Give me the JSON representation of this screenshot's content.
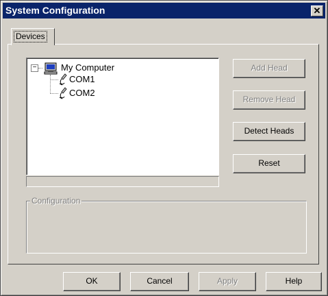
{
  "window": {
    "title": "System Configuration"
  },
  "tabs": [
    {
      "label": "Devices"
    }
  ],
  "tree": {
    "root": {
      "label": "My Computer",
      "expanded": true,
      "expander_glyph": "−",
      "icon": "computer-icon"
    },
    "children": [
      {
        "label": "COM1",
        "icon": "serial-port-icon"
      },
      {
        "label": "COM2",
        "icon": "serial-port-icon"
      }
    ]
  },
  "buttons": {
    "add_head": {
      "label": "Add Head",
      "enabled": false
    },
    "remove_head": {
      "label": "Remove Head",
      "enabled": false
    },
    "detect_heads": {
      "label": "Detect Heads",
      "enabled": true
    },
    "reset": {
      "label": "Reset",
      "enabled": true
    }
  },
  "configuration_group": {
    "label": "Configuration"
  },
  "footer_buttons": {
    "ok": {
      "label": "OK",
      "enabled": true
    },
    "cancel": {
      "label": "Cancel",
      "enabled": true
    },
    "apply": {
      "label": "Apply",
      "enabled": false
    },
    "help": {
      "label": "Help",
      "enabled": true
    }
  },
  "colors": {
    "titlebar": "#0a246a",
    "face": "#d4d0c8",
    "disabled_text": "#808080"
  }
}
